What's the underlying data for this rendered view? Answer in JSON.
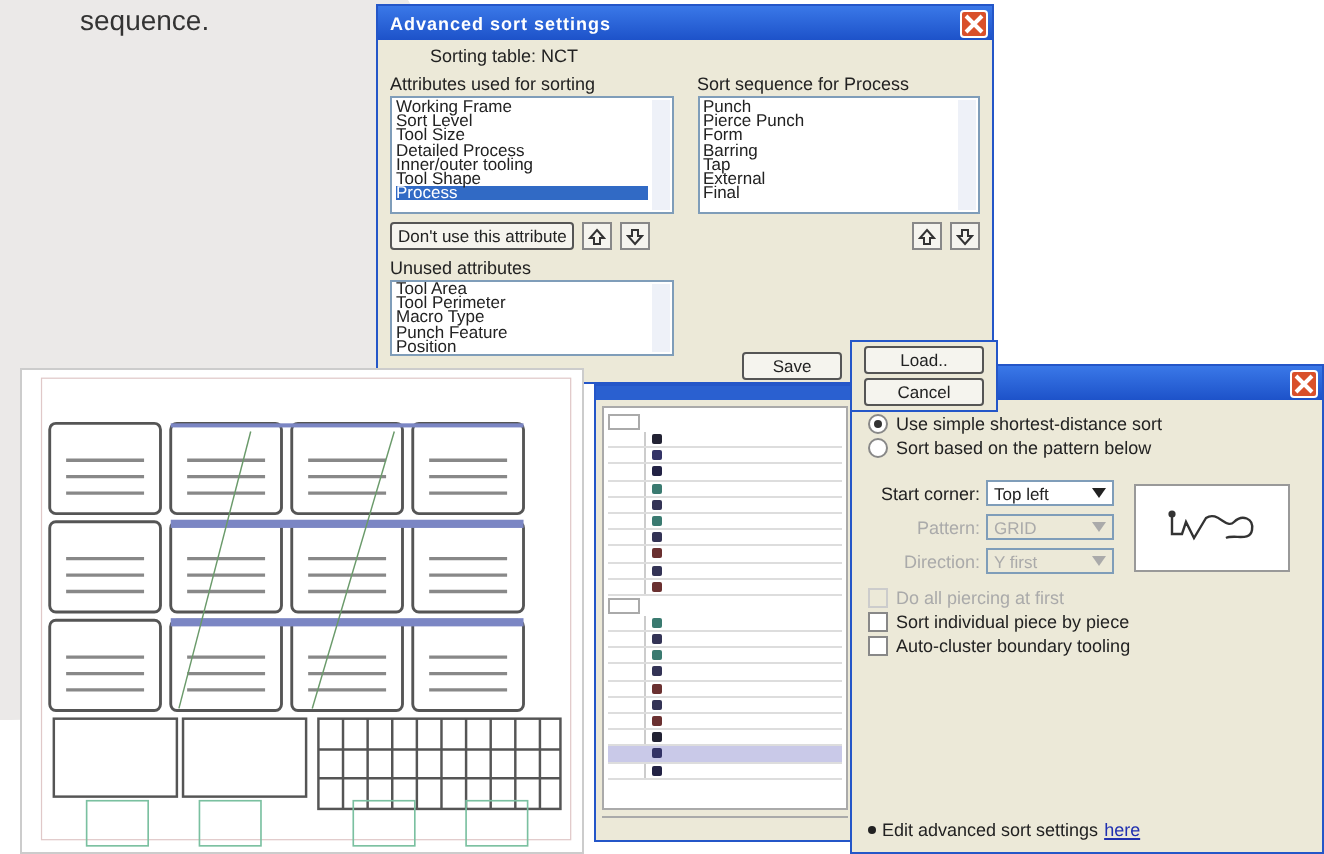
{
  "page_text": "sequence.",
  "sort_dialog": {
    "title": "Advanced sort settings",
    "table_label": "Sorting table: NCT",
    "used_label": "Attributes used for sorting",
    "used_items": [
      {
        "label": "Working Frame",
        "selected": false
      },
      {
        "label": "Sort Level",
        "selected": false
      },
      {
        "label": "Tool Size",
        "selected": false
      },
      {
        "label": "Detailed Process",
        "selected": false
      },
      {
        "label": "Inner/outer tooling",
        "selected": false
      },
      {
        "label": "Tool Shape",
        "selected": false
      },
      {
        "label": "Process",
        "selected": true
      }
    ],
    "remove_button": "Don't use this attribute",
    "sequence_label": "Sort sequence for Process",
    "sequence_items": [
      "Punch",
      "Pierce Punch",
      "Form",
      "Barring",
      "Tap",
      "External",
      "Final"
    ],
    "unused_label": "Unused attributes",
    "unused_items": [
      "Tool Area",
      "Tool Perimeter",
      "Macro Type",
      "Punch Feature",
      "Position"
    ],
    "save_button": "Save",
    "load_button": "Load..",
    "cancel_button": "Cancel"
  },
  "sort_options_dialog": {
    "radios": [
      {
        "label": "Use simple shortest-distance sort",
        "selected": true
      },
      {
        "label": "Sort based on the pattern below",
        "selected": false
      }
    ],
    "fields": [
      {
        "label": "Start corner:",
        "value": "Top left",
        "disabled": false
      },
      {
        "label": "Pattern:",
        "value": "GRID",
        "disabled": true
      },
      {
        "label": "Direction:",
        "value": "Y first",
        "disabled": true
      }
    ],
    "checkboxes": [
      {
        "label": "Do all piercing at first",
        "checked": false,
        "disabled": true
      },
      {
        "label": "Sort individual piece by piece",
        "checked": false,
        "disabled": false
      },
      {
        "label": "Auto-cluster boundary tooling",
        "checked": false,
        "disabled": false
      }
    ],
    "footer_text": "Edit advanced sort settings",
    "footer_link": "here"
  }
}
